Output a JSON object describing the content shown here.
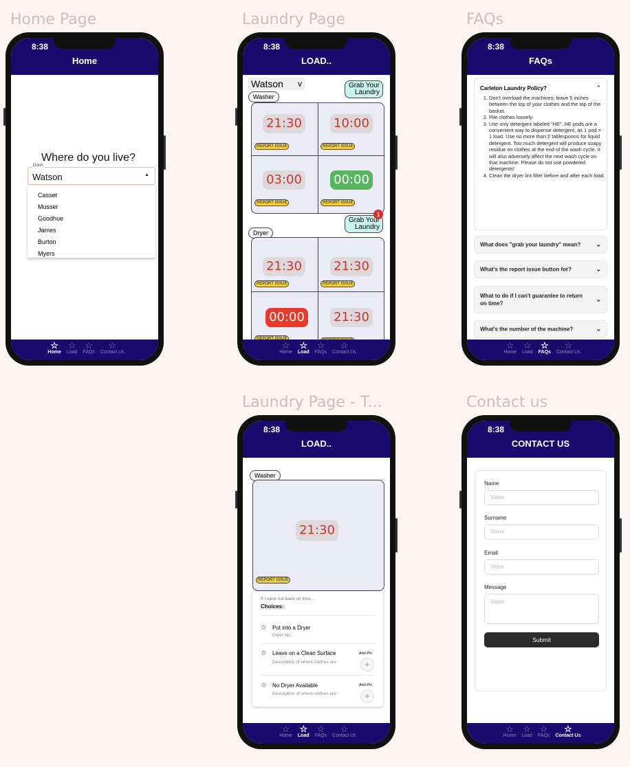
{
  "frames": {
    "home": "Home Page",
    "laundry": "Laundry Page",
    "faqs": "FAQs",
    "laundry_t": "Laundry Page - T...",
    "contact": "Contact us"
  },
  "status_time": "8:38",
  "tabs": [
    "Home",
    "Load",
    "FAQs",
    "Contact Us"
  ],
  "home": {
    "header": "Home",
    "question": "Where do you live?",
    "field_label": "Dorm",
    "selected": "Watson",
    "options": [
      "Casset",
      "Musser",
      "Goodhue",
      "James",
      "Burton",
      "Myers"
    ]
  },
  "laundry": {
    "header": "LOAD..",
    "dorm": "Watson",
    "dorm_arrow": "v",
    "grab": "Grab Your Laundry",
    "badge": "1",
    "washer_label": "Washer",
    "dryer_label": "Dryer",
    "report": "REPORT ISSUE",
    "washer_timers": [
      "21:30",
      "10:00",
      "03:00",
      "00:00"
    ],
    "dryer_timers": [
      "21:30",
      "21:30",
      "00:00",
      "21:30"
    ]
  },
  "faqs": {
    "header": "FAQs",
    "policy_title": "Carleton Laundry Policy?",
    "policy_items": [
      "Don't overload the machines: leave 5 inches between the top of your clothes and the top of the basket.",
      "Pile clothes loosely.",
      "Use only detergent labeled \"HE\". HE pods are a convenient way to dispense detergent, as 1 pod = 1 load. Use no more than 2 tablespoons for liquid detergent. Too much detergent will produce soapy residue on clothes at the end of the wash cycle. It will also adversely affect the next wash cycle on that machine. Please do not use powdered detergents!",
      "Clean the dryer lint filter before and after each load."
    ],
    "questions": [
      "What does \"grab your laundry\" mean?",
      "What's the report issue button for?",
      "What to do if I can't guarantee to return on time?",
      "What's the number of the machine?"
    ]
  },
  "laundry_t": {
    "header": "LOAD..",
    "washer_label": "Washer",
    "timer": "21:30",
    "report": "REPORT ISSUE",
    "prompt": "If I were not back on time...",
    "choices_title": "Choices:",
    "choices": [
      {
        "title": "Put into a Dryer",
        "sub": "Dryer No. :",
        "addpic": ""
      },
      {
        "title": "Leave on a Clean Surface",
        "sub": "Description of where clothes are:",
        "addpic": "Add Pic"
      },
      {
        "title": "No Dryer Available",
        "sub": "Description of where clothes are:",
        "addpic": "Add Pic"
      }
    ]
  },
  "contact": {
    "header": "CONTACT US",
    "fields": [
      {
        "label": "Name",
        "placeholder": "Value"
      },
      {
        "label": "Surname",
        "placeholder": "Value"
      },
      {
        "label": "Email",
        "placeholder": "Value"
      },
      {
        "label": "Message",
        "placeholder": "Value"
      }
    ],
    "submit": "Submit"
  }
}
